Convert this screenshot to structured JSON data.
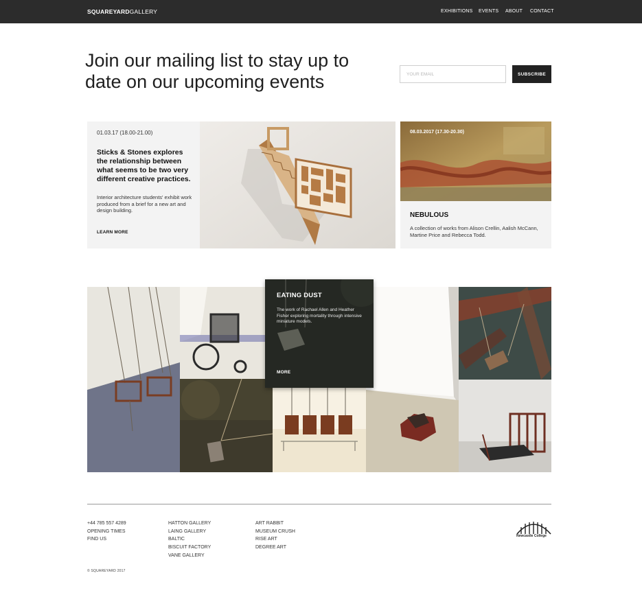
{
  "brand": {
    "bold": "SQUAREYARD",
    "light": "GALLERY"
  },
  "nav": {
    "items": [
      "EXHIBITIONS",
      "EVENTS",
      "ABOUT",
      "CONTACT"
    ]
  },
  "mailing": {
    "heading": "Join our mailing list to stay up to date on our upcoming events",
    "email_placeholder": "YOUR EMAIL",
    "email_value": "",
    "subscribe_label": "SUBSCRIBE"
  },
  "events": {
    "featured": {
      "date": "01.03.17 (18.00-21.00)",
      "title": "Sticks & Stones explores the relationship between what seems to be two very different creative practices.",
      "description": "Interior architecture students' exhibit work produced from a brief for a new art and design building.",
      "link": "LEARN MORE"
    },
    "secondary": {
      "date": "08.03.2017 (17.30-20.30)",
      "title": "NEBULOUS",
      "description": "A collection of works from Alison Crellin, Aalish McCann, Martine Price and Rebecca Todd."
    }
  },
  "gallery": {
    "card": {
      "title": "EATING DUST",
      "description": "The work of Rachael Allen and Heather Fisher exploring mortality through intensive miniature models.",
      "link": "MORE"
    }
  },
  "footer": {
    "contact": [
      "+44 785 557 4289",
      "OPENING TIMES",
      "FIND US"
    ],
    "galleries": [
      "HATTON GALLERY",
      "LAING GALLERY",
      "BALTIC",
      "BISCUIT FACTORY",
      "VANE GALLERY"
    ],
    "links": [
      "ART RABBIT",
      "MUSEUM CRUSH",
      "RISE ART",
      "DEGREE ART"
    ],
    "logo_text": "Newcastle College",
    "copyright": "© SQUAREYARD 2017"
  },
  "colors": {
    "topbar": "#2c2c2c",
    "button": "#222222",
    "card_bg": "#f3f3f3"
  },
  "icons": {
    "logo": "bridge-arch-logo"
  }
}
